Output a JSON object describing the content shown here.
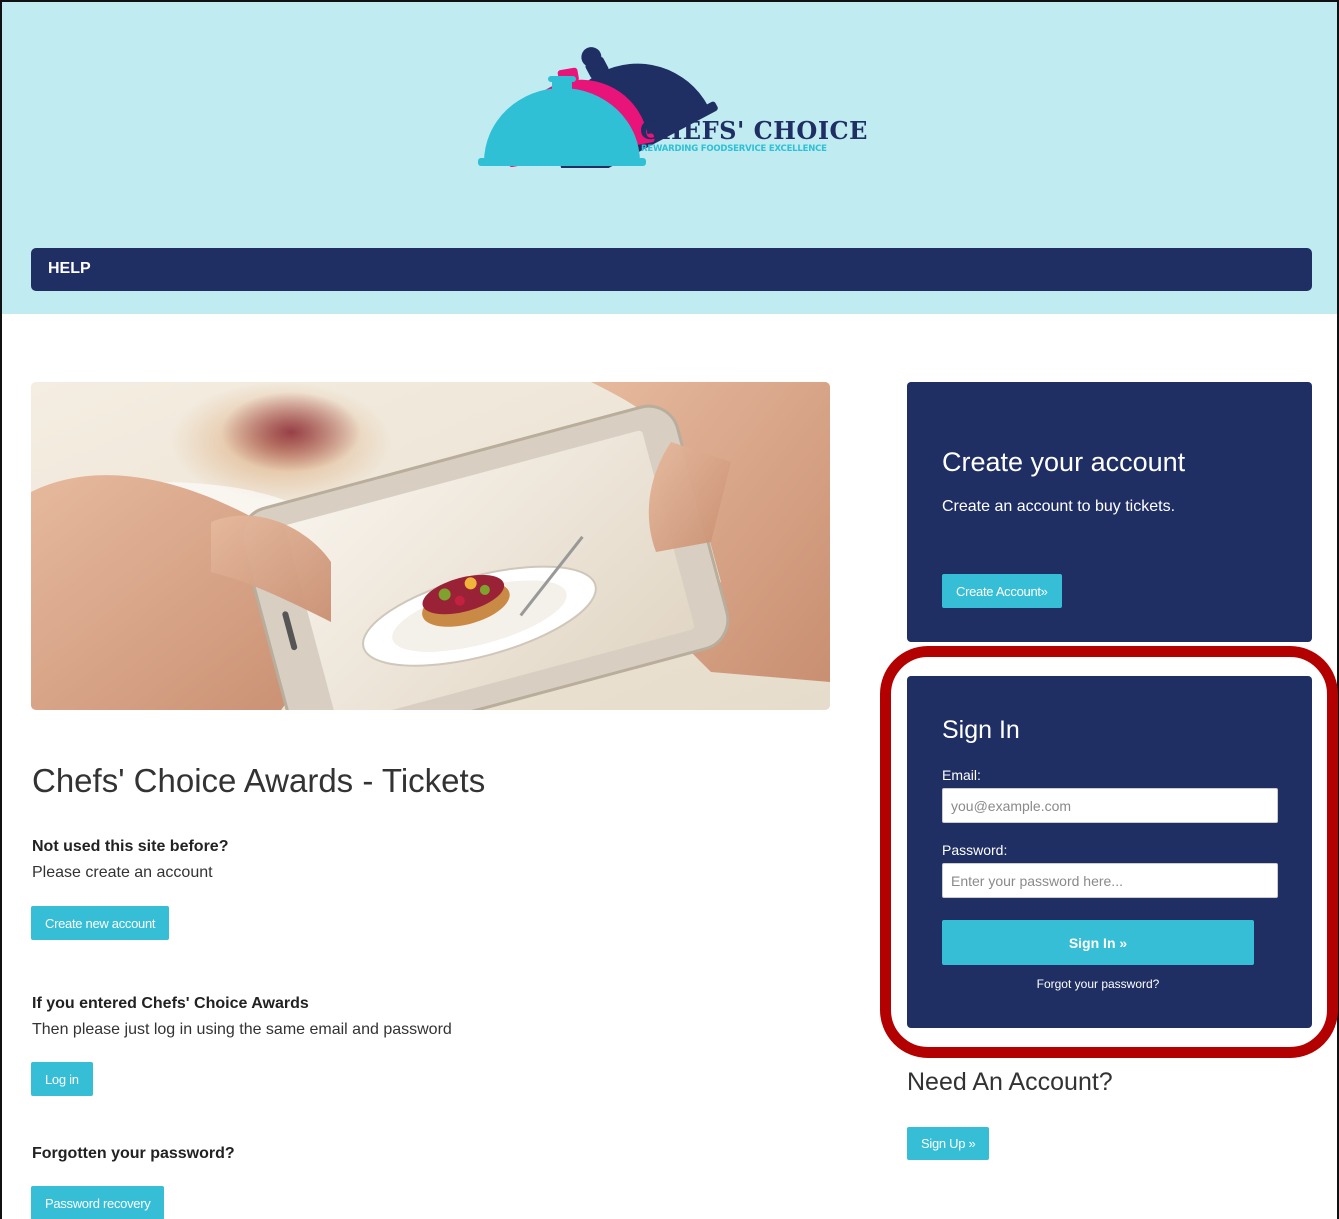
{
  "brand": {
    "name": "CHEFS' CHOICE",
    "tagline": "REWARDING FOODSERVICE EXCELLENCE",
    "colors": {
      "navy": "#1f2e63",
      "cyan": "#35bed6",
      "pink": "#e8147a",
      "header_bg": "#c0ebf1",
      "highlight": "#b30000"
    }
  },
  "nav": {
    "help_label": "HELP"
  },
  "main": {
    "title": "Chefs' Choice Awards - Tickets",
    "sections": [
      {
        "heading": "Not used this site before?",
        "text": "Please create an account",
        "button": "Create new account"
      },
      {
        "heading": "If you entered Chefs' Choice Awards",
        "text": "Then please just log in using the same email and password",
        "button": "Log in"
      },
      {
        "heading": "Forgotten your password?",
        "button": "Password recovery"
      }
    ]
  },
  "create_panel": {
    "title": "Create your account",
    "text": "Create an account to buy tickets.",
    "button": "Create Account»"
  },
  "signin_panel": {
    "title": "Sign In",
    "email_label": "Email:",
    "email_placeholder": "you@example.com",
    "password_label": "Password:",
    "password_placeholder": "Enter your password here...",
    "button": "Sign In »",
    "forgot": "Forgot your password?"
  },
  "need_account": {
    "title": "Need An Account?",
    "button": "Sign Up »"
  },
  "icons": [
    "cloche-logo-icon",
    "hero-photo"
  ]
}
